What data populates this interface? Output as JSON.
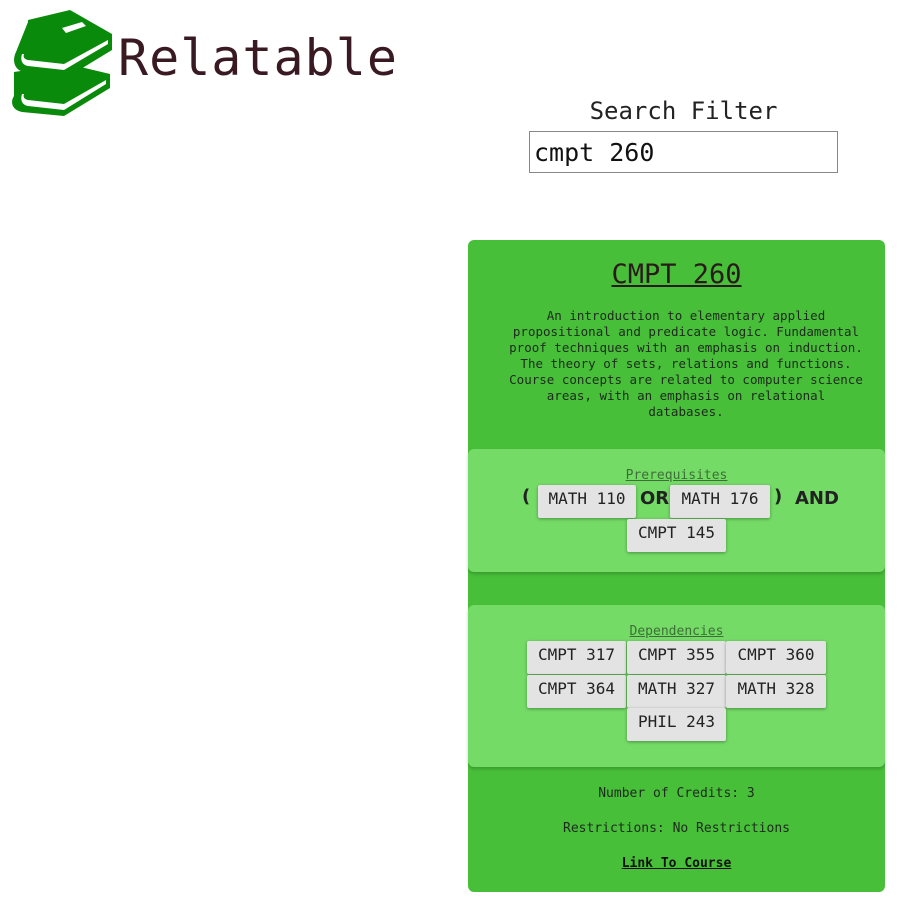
{
  "app": {
    "title": "Relatable",
    "logo_icon": "books-icon",
    "logo_color": "#0a8a0a"
  },
  "search": {
    "label": "Search Filter",
    "value": "cmpt 260"
  },
  "course": {
    "code": "CMPT 260",
    "description": "An introduction to elementary applied propositional and predicate logic. Fundamental proof techniques with an emphasis on induction. The theory of sets, relations and functions. Course concepts are related to computer science areas, with an emphasis on relational databases.",
    "prerequisites": {
      "label": "Prerequisites",
      "open_paren": "(",
      "close_paren": ")",
      "or": "OR",
      "and": "AND",
      "courses": [
        "MATH 110",
        "MATH 176",
        "CMPT 145"
      ]
    },
    "dependencies": {
      "label": "Dependencies",
      "courses": [
        "CMPT 317",
        "CMPT 355",
        "CMPT 360",
        "CMPT 364",
        "MATH 327",
        "MATH 328",
        "PHIL 243"
      ]
    },
    "credits": "Number of Credits: 3",
    "restrictions": "Restrictions: No Restrictions",
    "link_label": "Link To Course"
  },
  "colors": {
    "card": "#47bf38",
    "panel": "#74db66",
    "chip": "#e3e3e3"
  }
}
